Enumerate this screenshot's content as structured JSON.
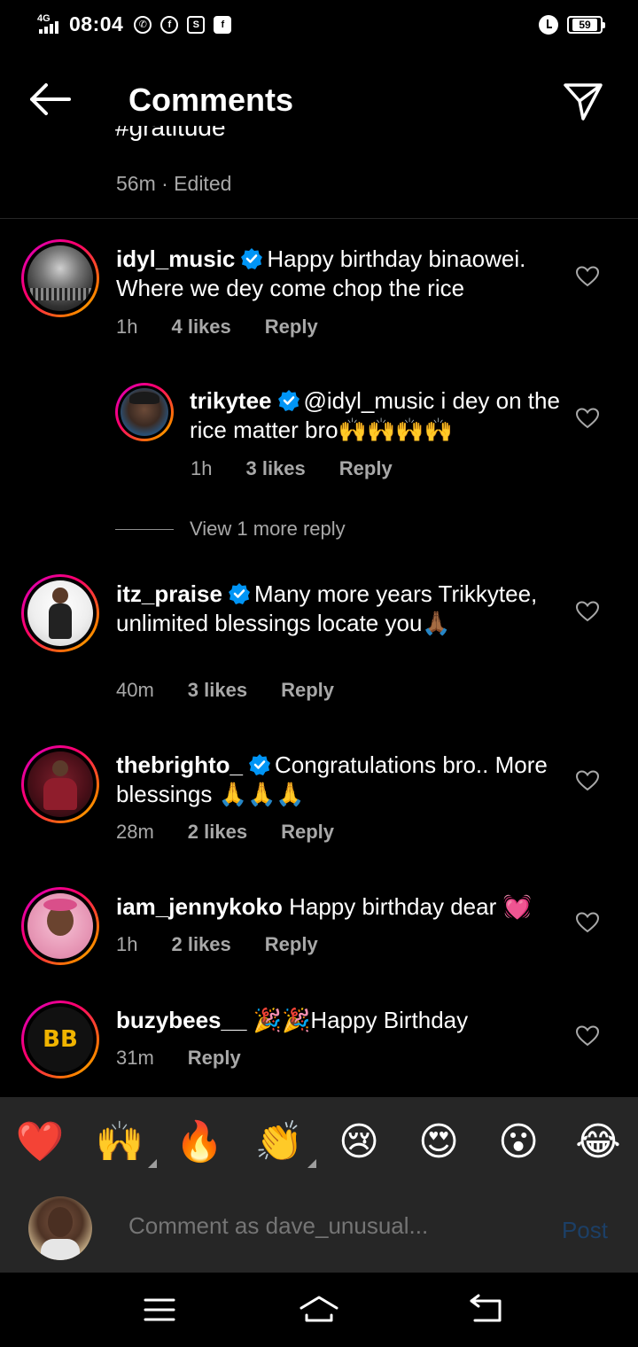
{
  "status_bar": {
    "network": "4G",
    "time": "08:04",
    "battery": "59",
    "icons": [
      "whatsapp-icon",
      "facebook-icon",
      "screenshot-icon",
      "facebook-app-icon"
    ]
  },
  "header": {
    "title": "Comments"
  },
  "caption": {
    "partial_text": "#gratitude",
    "meta": "56m · Edited"
  },
  "comments": [
    {
      "username": "idyl_music",
      "verified": true,
      "text": "Happy birthday binaowei. Where we dey come chop the rice",
      "time": "1h",
      "likes": "4 likes",
      "reply": "Reply"
    },
    {
      "username": "trikytee",
      "verified": true,
      "text": "@idyl_music i dey on the rice matter bro🙌🙌🙌🙌",
      "time": "1h",
      "likes": "3 likes",
      "reply": "Reply"
    },
    {
      "username": "itz_praise",
      "verified": true,
      "text": "Many more years Trikkytee, unlimited blessings locate you🙏🏾",
      "time": "40m",
      "likes": "3 likes",
      "reply": "Reply"
    },
    {
      "username": "thebrighto_",
      "verified": true,
      "text": "Congratulations bro.. More blessings 🙏🙏🙏",
      "time": "28m",
      "likes": "2 likes",
      "reply": "Reply"
    },
    {
      "username": "iam_jennykoko",
      "verified": false,
      "text": "Happy birthday dear 💓",
      "time": "1h",
      "likes": "2 likes",
      "reply": "Reply"
    },
    {
      "username": "buzybees__",
      "verified": false,
      "text": "🎉🎉Happy Birthday",
      "time": "31m",
      "likes": "",
      "reply": "Reply"
    }
  ],
  "view_more": "View 1 more reply",
  "reactions": [
    "❤️",
    "🙌",
    "🔥",
    "👏",
    "😢",
    "😍",
    "😮",
    "😂"
  ],
  "composer": {
    "placeholder": "Comment as dave_unusual...",
    "post_label": "Post"
  },
  "colors": {
    "background": "#000000",
    "panel": "#262626",
    "muted_text": "#a8a8a8",
    "verified_blue": "#0095f6",
    "post_disabled": "#1c3f66"
  }
}
